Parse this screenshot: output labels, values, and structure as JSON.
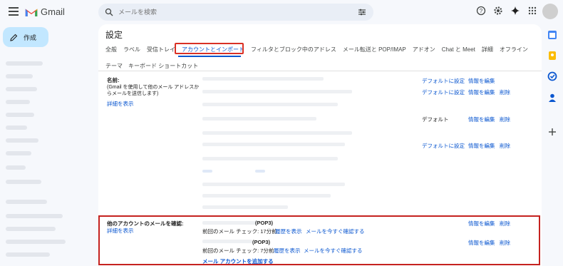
{
  "app": {
    "name": "Gmail"
  },
  "search": {
    "placeholder": "メールを検索"
  },
  "compose": {
    "label": "作成"
  },
  "settings": {
    "title": "設定",
    "tabs": [
      "全般",
      "ラベル",
      "受信トレイ",
      "アカウントとインポート",
      "フィルタとブロック中のアドレス",
      "メール転送と POP/IMAP",
      "アドオン",
      "Chat と Meet",
      "詳細",
      "オフライン"
    ],
    "tabs_row2": [
      "テーマ",
      "キーボード ショートカット"
    ],
    "active_tab": "アカウントとインポート"
  },
  "name_section": {
    "label": "名前:",
    "description": "(Gmail を使用して他のメール アドレスからメールを送信します)",
    "details_link": "詳細を表示",
    "rows": [
      {
        "default": "デフォルトに設定",
        "edit": "情報を編集",
        "delete": ""
      },
      {
        "default": "デフォルトに設定",
        "edit": "情報を編集",
        "delete": "削除"
      },
      {
        "default": "デフォルト",
        "edit": "情報を編集",
        "delete": "削除"
      },
      {
        "default": "デフォルトに設定",
        "edit": "情報を編集",
        "delete": "削除"
      }
    ]
  },
  "check_section": {
    "label": "他のアカウントのメールを確認:",
    "details_link": "詳細を表示",
    "accounts": [
      {
        "protocol": "(POP3)",
        "last_check": "前回のメール チェック: 17分前",
        "history": "履歴を表示",
        "check_now": "メールを今すぐ確認する",
        "edit": "情報を編集",
        "delete": "削除"
      },
      {
        "protocol": "(POP3)",
        "last_check": "前回のメール チェック: 7分前",
        "history": "履歴を表示",
        "check_now": "メールを今すぐ確認する",
        "edit": "情報を編集",
        "delete": "削除"
      }
    ],
    "add_account": "メール アカウントを追加する"
  },
  "colors": {
    "accent": "#0b57d0",
    "highlight": "#d93025",
    "compose_bg": "#c2e7ff"
  }
}
